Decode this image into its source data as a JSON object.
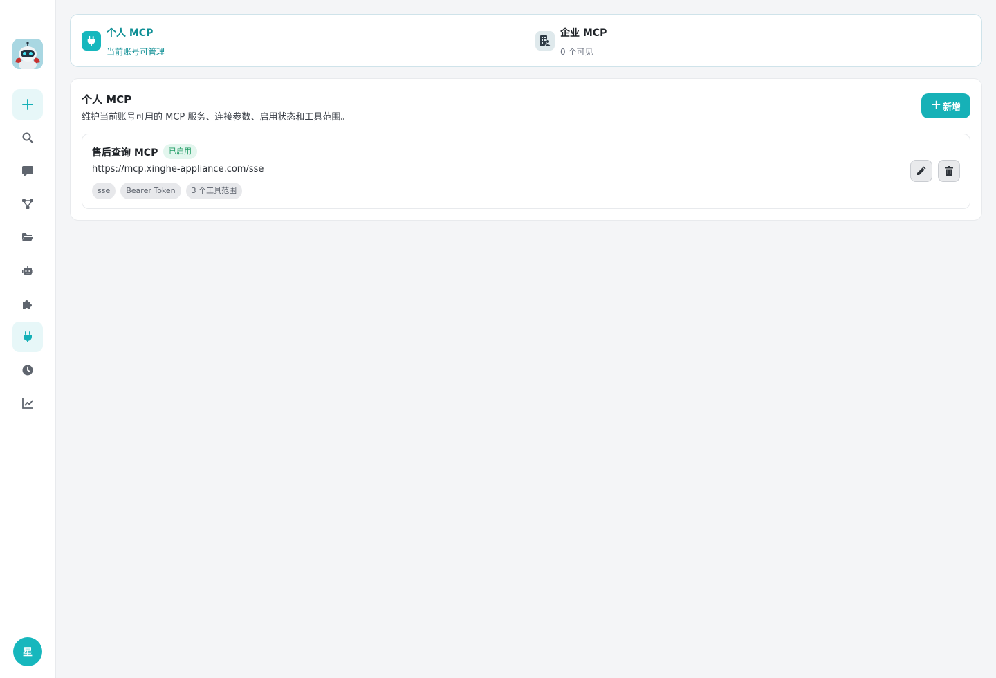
{
  "sidebar": {
    "logo_icon": "robot-mascot-icon",
    "items": [
      {
        "name": "new",
        "icon": "plus-icon",
        "active": false
      },
      {
        "name": "search",
        "icon": "search-icon",
        "active": false
      },
      {
        "name": "chat",
        "icon": "chat-bubble-icon",
        "active": false
      },
      {
        "name": "workflow",
        "icon": "flow-icon",
        "active": false
      },
      {
        "name": "files",
        "icon": "folder-open-icon",
        "active": false
      },
      {
        "name": "agents",
        "icon": "robot-icon",
        "active": false
      },
      {
        "name": "plugins",
        "icon": "puzzle-icon",
        "active": false
      },
      {
        "name": "mcp",
        "icon": "plug-icon",
        "active": true
      },
      {
        "name": "history",
        "icon": "clock-icon",
        "active": false
      },
      {
        "name": "analytics",
        "icon": "chart-line-icon",
        "active": false
      }
    ],
    "user_avatar": "星"
  },
  "scope": {
    "personal": {
      "title": "个人 MCP",
      "subtitle": "当前账号可管理"
    },
    "enterprise": {
      "title": "企业 MCP",
      "subtitle": "0 个可见"
    }
  },
  "panel": {
    "title": "个人 MCP",
    "description": "维护当前账号可用的 MCP 服务、连接参数、启用状态和工具范围。",
    "add_label": "新增",
    "add_plus": "+"
  },
  "mcp_items": [
    {
      "name": "售后查询 MCP",
      "status": "已启用",
      "url": "https://mcp.xinghe-appliance.com/sse",
      "tags": [
        "sse",
        "Bearer Token",
        "3 个工具范围"
      ]
    }
  ],
  "colors": {
    "accent": "#16b1b7",
    "accent_text": "#0f8f95",
    "status_green": "#1e9b63"
  }
}
